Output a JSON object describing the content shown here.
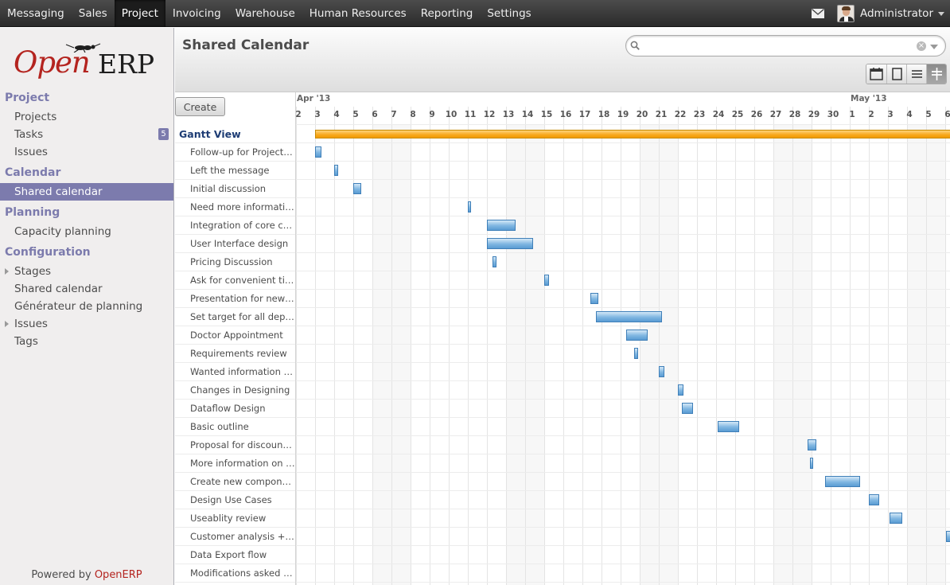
{
  "top_menu": {
    "items": [
      {
        "label": "Messaging",
        "active": false
      },
      {
        "label": "Sales",
        "active": false
      },
      {
        "label": "Project",
        "active": true
      },
      {
        "label": "Invoicing",
        "active": false
      },
      {
        "label": "Warehouse",
        "active": false
      },
      {
        "label": "Human Resources",
        "active": false
      },
      {
        "label": "Reporting",
        "active": false
      },
      {
        "label": "Settings",
        "active": false
      }
    ],
    "user": "Administrator",
    "icons": [
      "mail-icon",
      "avatar",
      "chevron-down-icon"
    ]
  },
  "logo": {
    "part1": "Open",
    "part2": "ERP"
  },
  "sidebar": {
    "sections": [
      {
        "title": "Project",
        "items": [
          {
            "label": "Projects"
          },
          {
            "label": "Tasks",
            "badge": "5"
          },
          {
            "label": "Issues"
          }
        ]
      },
      {
        "title": "Calendar",
        "items": [
          {
            "label": "Shared calendar",
            "active": true
          }
        ]
      },
      {
        "title": "Planning",
        "items": [
          {
            "label": "Capacity planning"
          }
        ]
      },
      {
        "title": "Configuration",
        "items": [
          {
            "label": "Stages",
            "expandable": true
          },
          {
            "label": "Shared calendar"
          },
          {
            "label": "Générateur de planning"
          },
          {
            "label": "Issues",
            "expandable": true
          },
          {
            "label": "Tags"
          }
        ]
      }
    ],
    "footer_prefix": "Powered by ",
    "footer_brand": "OpenERP"
  },
  "header": {
    "title": "Shared Calendar",
    "search_placeholder": "",
    "view_icons": [
      "calendar-view-icon",
      "form-view-icon",
      "list-view-icon",
      "gantt-view-icon"
    ],
    "active_view": "gantt-view-icon"
  },
  "gantt": {
    "create_label": "Create",
    "months": [
      {
        "label": "Apr '13",
        "start_index": 0
      },
      {
        "label": "May '13",
        "start_index": 29
      }
    ],
    "days": [
      "2",
      "3",
      "4",
      "5",
      "6",
      "7",
      "8",
      "9",
      "10",
      "11",
      "12",
      "13",
      "14",
      "15",
      "16",
      "17",
      "18",
      "19",
      "20",
      "21",
      "22",
      "23",
      "24",
      "25",
      "26",
      "27",
      "28",
      "29",
      "30",
      "1",
      "2",
      "3",
      "4",
      "5",
      "6"
    ],
    "weekend_indices": [
      4,
      5,
      11,
      12,
      18,
      19,
      25,
      26,
      32,
      33
    ],
    "group": {
      "label": "Gantt View",
      "start": 1,
      "end": 35
    },
    "tasks": [
      {
        "label": "Follow-up for Project pr...",
        "start": 1.0,
        "end": 1.35
      },
      {
        "label": "Left the message",
        "start": 2.0,
        "end": 2.2
      },
      {
        "label": "Initial discussion",
        "start": 3.0,
        "end": 3.4
      },
      {
        "label": "Need more information o...",
        "start": 9.0,
        "end": 9.15
      },
      {
        "label": "Integration of core com...",
        "start": 10.0,
        "end": 11.5
      },
      {
        "label": "User Interface design",
        "start": 10.0,
        "end": 12.4
      },
      {
        "label": "Pricing Discussion",
        "start": 10.3,
        "end": 10.5
      },
      {
        "label": "Ask for convenient time...",
        "start": 13.0,
        "end": 13.25
      },
      {
        "label": "Presentation for new Se...",
        "start": 15.4,
        "end": 15.85
      },
      {
        "label": "Set target for all depar...",
        "start": 15.7,
        "end": 19.15
      },
      {
        "label": "Doctor Appointment",
        "start": 17.3,
        "end": 18.4
      },
      {
        "label": "Requirements review",
        "start": 17.7,
        "end": 17.9
      },
      {
        "label": "Wanted information abou...",
        "start": 19.0,
        "end": 19.3
      },
      {
        "label": "Changes in Designing",
        "start": 20.0,
        "end": 20.3
      },
      {
        "label": "Dataflow Design",
        "start": 20.2,
        "end": 20.8
      },
      {
        "label": "Basic outline",
        "start": 22.1,
        "end": 23.2
      },
      {
        "label": "Proposal for discount offer",
        "start": 26.8,
        "end": 27.25
      },
      {
        "label": "More information on the...",
        "start": 26.9,
        "end": 27.1
      },
      {
        "label": "Create new components",
        "start": 27.7,
        "end": 29.55
      },
      {
        "label": "Design Use Cases",
        "start": 30.0,
        "end": 30.55
      },
      {
        "label": "Useablity review",
        "start": 31.1,
        "end": 31.75
      },
      {
        "label": "Customer analysis + Arc...",
        "start": 34.05,
        "end": 34.6
      },
      {
        "label": "Data Export flow",
        "start": null,
        "end": null
      },
      {
        "label": "Modifications asked by ...",
        "start": null,
        "end": null
      }
    ]
  }
}
